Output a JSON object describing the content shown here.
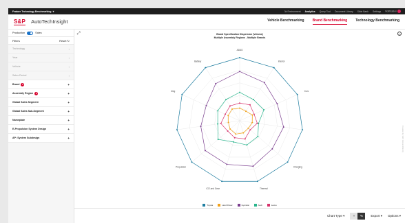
{
  "topbar": {
    "app_name": "Feature Technology Benchmarking",
    "nav": [
      "3d Environment",
      "Analytics",
      "Query Tool",
      "Document Library",
      "Slide Bank",
      "Settings",
      "Notification"
    ],
    "active_nav": "Analytics"
  },
  "header": {
    "logo": "S&P",
    "product": "AutoTechInsight",
    "tabs": [
      "Vehicle Benchmarking",
      "Brand Benchmarking",
      "Technology Benchmarking"
    ],
    "active_tab": "Brand Benchmarking"
  },
  "sidebar": {
    "toggle_left": "Production",
    "toggle_right": "Sales",
    "filters_label": "Filters",
    "reset_label": "Reset",
    "items": [
      {
        "label": "Technology",
        "strong": false,
        "badge": ""
      },
      {
        "label": "Year",
        "strong": false,
        "badge": ""
      },
      {
        "label": "Vehicle",
        "strong": false,
        "badge": ""
      },
      {
        "label": "Sales Period",
        "strong": false,
        "badge": ""
      },
      {
        "label": "Brand",
        "strong": true,
        "badge": "5"
      },
      {
        "label": "Assembly Region",
        "strong": true,
        "badge": "6"
      },
      {
        "label": "Global Sales Segment",
        "strong": true,
        "badge": ""
      },
      {
        "label": "Global Sales Sub-Segment",
        "strong": true,
        "badge": ""
      },
      {
        "label": "Nameplate",
        "strong": true,
        "badge": ""
      },
      {
        "label": "E-Propulsion System Design",
        "strong": true,
        "badge": ""
      },
      {
        "label": "AP: System Subdesign",
        "strong": true,
        "badge": ""
      }
    ]
  },
  "chart": {
    "title_line1": "Brand Specification Dispersion (Volume)",
    "title_line2": "Multiple Assembly Regions - Multiple Brands",
    "side_note": "Created by S&P Global Mobility"
  },
  "chart_data": {
    "type": "radar",
    "axes": [
      "ADAS",
      "Interior",
      "Connected Car",
      "Chassis",
      "Charging",
      "Thermal",
      "ICE and Gear",
      "Propulsion",
      "Autonomy",
      "Lighting",
      "Battery"
    ],
    "rlim": [
      0,
      100
    ],
    "grid": true,
    "legend_position": "bottom",
    "series": [
      {
        "name": "Toyota",
        "color": "#1f7ea1",
        "values": [
          100,
          100,
          100,
          100,
          100,
          100,
          100,
          100,
          100,
          100,
          100
        ]
      },
      {
        "name": "Land Rover",
        "color": "#f2a21b",
        "values": [
          20,
          18,
          22,
          20,
          18,
          20,
          22,
          20,
          18,
          20,
          22
        ]
      },
      {
        "name": "Hyundai",
        "color": "#7b3f8f",
        "values": [
          78,
          72,
          65,
          70,
          68,
          75,
          72,
          72,
          62,
          58,
          70
        ]
      },
      {
        "name": "Audi",
        "color": "#2bb58d",
        "values": [
          45,
          40,
          42,
          30,
          38,
          40,
          35,
          45,
          35,
          38,
          40
        ]
      },
      {
        "name": "Lexus",
        "color": "#d6336c",
        "values": [
          28,
          30,
          25,
          28,
          22,
          30,
          28,
          25,
          30,
          25,
          28
        ]
      }
    ]
  },
  "bottombar": {
    "chart_type_label": "Chart Type",
    "seg_left": "#",
    "seg_right": "%",
    "export_label": "Export",
    "options_label": "Options"
  }
}
